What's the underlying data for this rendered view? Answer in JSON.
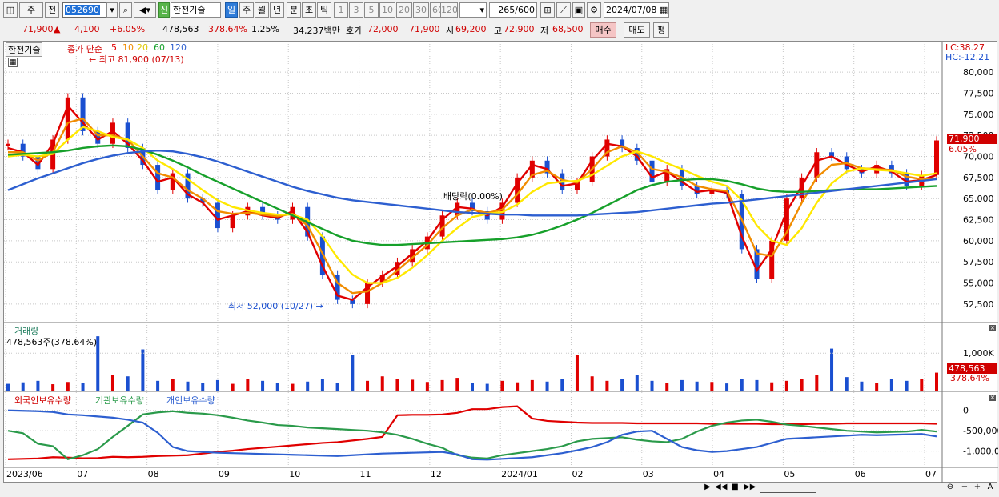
{
  "toolbar": {
    "market": "주",
    "prev": "전",
    "code": "052690",
    "sin": "신",
    "name": "한전기술",
    "periods": [
      "일",
      "주",
      "월",
      "년",
      "분",
      "초",
      "틱"
    ],
    "ticks": [
      "1",
      "3",
      "5",
      "10",
      "20",
      "30",
      "60",
      "120"
    ],
    "count": "265",
    "count_max": "/600",
    "date": "2024/07/08"
  },
  "quote": {
    "price": "71,900",
    "arrow": "▲",
    "change": "4,100",
    "change_pct": "+6.05%",
    "volume": "478,563",
    "volume_pct": "378.64%",
    "turnover": "1.25%",
    "amount": "34,237백만",
    "ask_label": "호가",
    "ask": "72,000",
    "bid": "71,900",
    "open_label": "시",
    "open": "69,200",
    "high_label": "고",
    "high": "72,900",
    "low_label": "저",
    "low": "68,500",
    "buy": "매수",
    "sell": "매도",
    "avg": "평"
  },
  "price_panel": {
    "name": "한전기술",
    "ma_label": "종가 단순",
    "ma_periods": [
      "5",
      "10",
      "20",
      "60",
      "120"
    ],
    "high_note": "최고 81,900 (07/13)",
    "low_note": "최저 52,000 (10/27)",
    "div_note": "배당락(0.00%)",
    "lc": "LC:38.27",
    "hc": "HC:-12.21",
    "cur_price": "71,900",
    "cur_pct": "6.05%"
  },
  "volume_panel": {
    "title": "거래량",
    "value": "478,563주(378.64%)",
    "cur": "478,563",
    "cur_pct": "378.64%"
  },
  "holding_panel": {
    "s1": "외국인보유수량",
    "s2": "기관보유수량",
    "s3": "개인보유수량"
  },
  "colors": {
    "ma5": "#e00000",
    "ma10": "#f08c00",
    "ma20": "#ffe800",
    "ma60": "#16a02a",
    "ma120": "#2d5fd0",
    "up": "#e00000",
    "down": "#1a4fd0",
    "foreign": "#e00000",
    "inst": "#2a9a4a",
    "indiv": "#2d5fd0"
  },
  "chart_data": [
    {
      "type": "line",
      "title": "한전기술",
      "x": [
        "2023/06",
        "07",
        "08",
        "09",
        "10",
        "11",
        "12",
        "2024/01",
        "02",
        "03",
        "04",
        "05",
        "06",
        "07"
      ],
      "ylim": [
        50400,
        82200
      ],
      "yticks": [
        52500,
        55000,
        57500,
        60000,
        62500,
        65000,
        67500,
        70000,
        72500,
        75000,
        77500,
        80000
      ],
      "series": [
        {
          "name": "종가",
          "values": [
            71500,
            70000,
            68500,
            72000,
            77000,
            73000,
            71500,
            74000,
            71000,
            69000,
            66000,
            68000,
            65000,
            64500,
            61500,
            63000,
            64000,
            63000,
            62500,
            64000,
            60500,
            56000,
            53000,
            52500,
            55000,
            56000,
            57500,
            59000,
            60500,
            63000,
            64500,
            63500,
            62500,
            64500,
            67500,
            69500,
            68000,
            66000,
            67000,
            70000,
            72000,
            71000,
            69500,
            67000,
            68500,
            66500,
            65500,
            66000,
            65500,
            59000,
            55500,
            60000,
            65000,
            67500,
            70500,
            70000,
            68500,
            68000,
            69000,
            68000,
            66500,
            67800,
            71900
          ]
        },
        {
          "name": "5",
          "values": [
            71000,
            70500,
            69000,
            71500,
            76000,
            74000,
            72000,
            73000,
            71500,
            69500,
            67000,
            67500,
            65500,
            64500,
            62500,
            63000,
            63500,
            63000,
            62700,
            63500,
            61000,
            57000,
            53500,
            53000,
            54500,
            55800,
            57000,
            58500,
            60000,
            62500,
            64000,
            63800,
            63000,
            64000,
            66800,
            69000,
            68500,
            66500,
            66800,
            69500,
            71500,
            71200,
            70000,
            67500,
            68200,
            67000,
            65800,
            66000,
            65700,
            60500,
            56500,
            59000,
            63500,
            66500,
            69500,
            70000,
            69000,
            68200,
            68800,
            68200,
            67000,
            67200,
            67800
          ]
        },
        {
          "name": "10",
          "values": [
            70500,
            70500,
            69500,
            70500,
            74000,
            74500,
            72500,
            72500,
            72000,
            70000,
            68000,
            67500,
            66000,
            65000,
            63500,
            63200,
            63300,
            63100,
            62900,
            63200,
            61800,
            58500,
            55000,
            53800,
            54000,
            55000,
            56500,
            58000,
            59500,
            61500,
            63000,
            63700,
            63300,
            63700,
            65500,
            67800,
            68300,
            67200,
            66900,
            68500,
            70500,
            71200,
            70500,
            68500,
            68200,
            67500,
            66500,
            66100,
            65900,
            62500,
            58500,
            58200,
            61000,
            64500,
            67500,
            69000,
            69200,
            68600,
            68500,
            68400,
            67600,
            67300,
            67400
          ]
        },
        {
          "name": "20",
          "values": [
            70000,
            70200,
            70000,
            70300,
            72000,
            73500,
            73000,
            72300,
            72000,
            71000,
            69500,
            68500,
            67300,
            66000,
            64800,
            64000,
            63600,
            63300,
            63100,
            63100,
            62500,
            60500,
            58000,
            56000,
            55000,
            55000,
            55600,
            56800,
            58300,
            60000,
            61500,
            62800,
            63200,
            63400,
            64300,
            65800,
            66800,
            67000,
            67100,
            67800,
            68900,
            70000,
            70600,
            70000,
            69200,
            68500,
            67700,
            67000,
            66500,
            64800,
            61800,
            60000,
            59500,
            61500,
            64500,
            66800,
            68200,
            68600,
            68400,
            68300,
            68000,
            67700,
            68000
          ]
        },
        {
          "name": "60",
          "values": [
            70200,
            70300,
            70400,
            70500,
            70700,
            71000,
            71200,
            71300,
            71200,
            70800,
            70200,
            69500,
            68700,
            67800,
            67000,
            66200,
            65400,
            64600,
            63800,
            63000,
            62200,
            61400,
            60600,
            60000,
            59700,
            59500,
            59500,
            59600,
            59700,
            59800,
            59900,
            60000,
            60100,
            60200,
            60400,
            60700,
            61200,
            61800,
            62500,
            63300,
            64200,
            65100,
            66000,
            66600,
            67000,
            67200,
            67300,
            67300,
            67100,
            66700,
            66200,
            65900,
            65800,
            65800,
            65900,
            66000,
            66100,
            66100,
            66100,
            66200,
            66300,
            66400,
            66500
          ]
        },
        {
          "name": "120",
          "values": [
            66000,
            66700,
            67400,
            68000,
            68600,
            69200,
            69700,
            70100,
            70400,
            70600,
            70700,
            70600,
            70300,
            69900,
            69400,
            68800,
            68200,
            67600,
            67000,
            66400,
            65900,
            65500,
            65100,
            64800,
            64600,
            64400,
            64200,
            64000,
            63800,
            63600,
            63400,
            63300,
            63200,
            63100,
            63100,
            63000,
            63000,
            63000,
            63000,
            63100,
            63200,
            63300,
            63400,
            63600,
            63800,
            64000,
            64200,
            64400,
            64500,
            64700,
            64900,
            65100,
            65300,
            65500,
            65700,
            65900,
            66100,
            66300,
            66500,
            66700,
            66900,
            67100,
            67300
          ]
        }
      ]
    },
    {
      "type": "bar",
      "title": "거래량",
      "yticks": [
        1000000
      ],
      "ylim": [
        0,
        1560000
      ],
      "values": [
        180,
        220,
        260,
        170,
        230,
        210,
        1450,
        420,
        380,
        1100,
        260,
        310,
        240,
        200,
        280,
        180,
        320,
        260,
        210,
        180,
        240,
        320,
        210,
        960,
        260,
        380,
        310,
        290,
        230,
        280,
        340,
        210,
        180,
        260,
        220,
        280,
        240,
        310,
        950,
        380,
        260,
        320,
        420,
        260,
        210,
        280,
        240,
        230,
        190,
        320,
        280,
        220,
        260,
        310,
        420,
        1120,
        360,
        240,
        210,
        300,
        260,
        320,
        479
      ]
    },
    {
      "type": "line",
      "title": "보유수량",
      "ylim": [
        -1400000,
        250000
      ],
      "yticks": [
        0,
        -500000,
        -1000000
      ],
      "series": [
        {
          "name": "외국인보유수량",
          "values": [
            -1200000,
            -1190000,
            -1180000,
            -1150000,
            -1160000,
            -1175000,
            -1170000,
            -1140000,
            -1150000,
            -1140000,
            -1120000,
            -1110000,
            -1100000,
            -1060000,
            -1020000,
            -990000,
            -950000,
            -920000,
            -890000,
            -860000,
            -830000,
            -800000,
            -780000,
            -740000,
            -700000,
            -650000,
            -120000,
            -110000,
            -110000,
            -100000,
            -60000,
            30000,
            30000,
            80000,
            100000,
            -200000,
            -260000,
            -280000,
            -300000,
            -310000,
            -310000,
            -310000,
            -320000,
            -320000,
            -320000,
            -320000,
            -320000,
            -330000,
            -330000,
            -330000,
            -330000,
            -340000,
            -340000,
            -340000,
            -330000,
            -330000,
            -320000,
            -320000,
            -320000,
            -320000,
            -320000,
            -320000,
            -330000
          ]
        },
        {
          "name": "기관보유수량",
          "values": [
            -500000,
            -560000,
            -820000,
            -880000,
            -1200000,
            -1100000,
            -950000,
            -650000,
            -380000,
            -100000,
            -50000,
            -20000,
            -60000,
            -80000,
            -120000,
            -180000,
            -250000,
            -300000,
            -360000,
            -380000,
            -420000,
            -440000,
            -460000,
            -480000,
            -500000,
            -540000,
            -600000,
            -700000,
            -820000,
            -920000,
            -1100000,
            -1160000,
            -1180000,
            -1100000,
            -1050000,
            -1000000,
            -950000,
            -880000,
            -760000,
            -700000,
            -680000,
            -660000,
            -720000,
            -760000,
            -780000,
            -700000,
            -520000,
            -380000,
            -300000,
            -250000,
            -230000,
            -280000,
            -350000,
            -380000,
            -420000,
            -460000,
            -500000,
            -520000,
            -540000,
            -530000,
            -520000,
            -480000,
            -520000
          ]
        },
        {
          "name": "개인보유수량",
          "values": [
            0,
            -10000,
            -20000,
            -40000,
            -100000,
            -120000,
            -150000,
            -180000,
            -230000,
            -300000,
            -550000,
            -900000,
            -1000000,
            -1020000,
            -1040000,
            -1050000,
            -1060000,
            -1070000,
            -1080000,
            -1090000,
            -1100000,
            -1110000,
            -1120000,
            -1100000,
            -1080000,
            -1060000,
            -1050000,
            -1040000,
            -1030000,
            -1020000,
            -1080000,
            -1200000,
            -1210000,
            -1190000,
            -1170000,
            -1150000,
            -1100000,
            -1050000,
            -980000,
            -900000,
            -780000,
            -600000,
            -520000,
            -500000,
            -700000,
            -900000,
            -980000,
            -1020000,
            -1000000,
            -950000,
            -900000,
            -800000,
            -700000,
            -680000,
            -660000,
            -640000,
            -620000,
            -600000,
            -610000,
            -600000,
            -590000,
            -580000,
            -640000
          ]
        }
      ]
    }
  ]
}
